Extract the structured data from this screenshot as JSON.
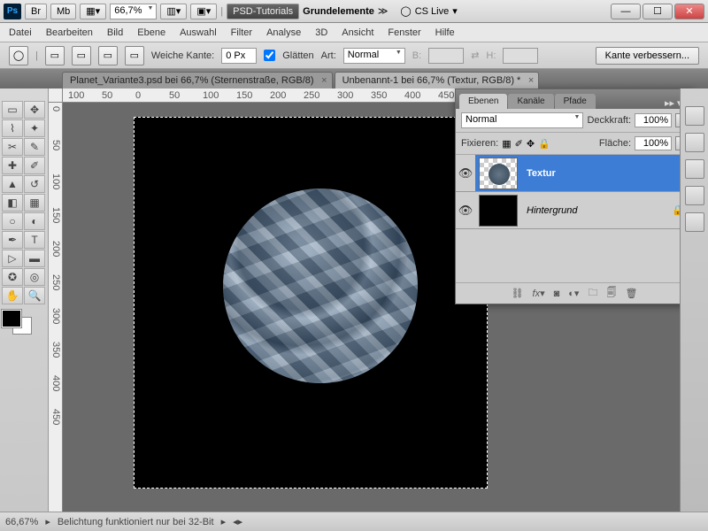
{
  "title": {
    "psd_tutorials": "PSD-Tutorials",
    "grundelemente": "Grundelemente",
    "cs_live": "CS Live"
  },
  "zoom_title": "66,7%",
  "menu": [
    "Datei",
    "Bearbeiten",
    "Bild",
    "Ebene",
    "Auswahl",
    "Filter",
    "Analyse",
    "3D",
    "Ansicht",
    "Fenster",
    "Hilfe"
  ],
  "options": {
    "weiche_kante": "Weiche Kante:",
    "weiche_kante_val": "0 Px",
    "glaetten": "Glätten",
    "art": "Art:",
    "art_val": "Normal",
    "b": "B:",
    "h": "H:",
    "kante": "Kante verbessern..."
  },
  "tabs": [
    "Planet_Variante3.psd bei 66,7% (Sternenstraße, RGB/8)",
    "Unbenannt-1 bei 66,7% (Textur, RGB/8) *"
  ],
  "ruler_h": [
    "100",
    "50",
    "0",
    "50",
    "100",
    "150",
    "200",
    "250",
    "300",
    "350",
    "400",
    "450"
  ],
  "ruler_v": [
    "0",
    "50",
    "100",
    "150",
    "200",
    "250",
    "300",
    "350",
    "400",
    "450"
  ],
  "panel": {
    "tabs": [
      "Ebenen",
      "Kanäle",
      "Pfade"
    ],
    "blend": "Normal",
    "deckkraft": "Deckkraft:",
    "deckkraft_val": "100%",
    "fixieren": "Fixieren:",
    "flaeche": "Fläche:",
    "flaeche_val": "100%",
    "layers": [
      {
        "name": "Textur",
        "selected": true
      },
      {
        "name": "Hintergrund",
        "locked": true
      }
    ]
  },
  "status": {
    "zoom": "66,67%",
    "msg": "Belichtung funktioniert nur bei 32-Bit"
  }
}
